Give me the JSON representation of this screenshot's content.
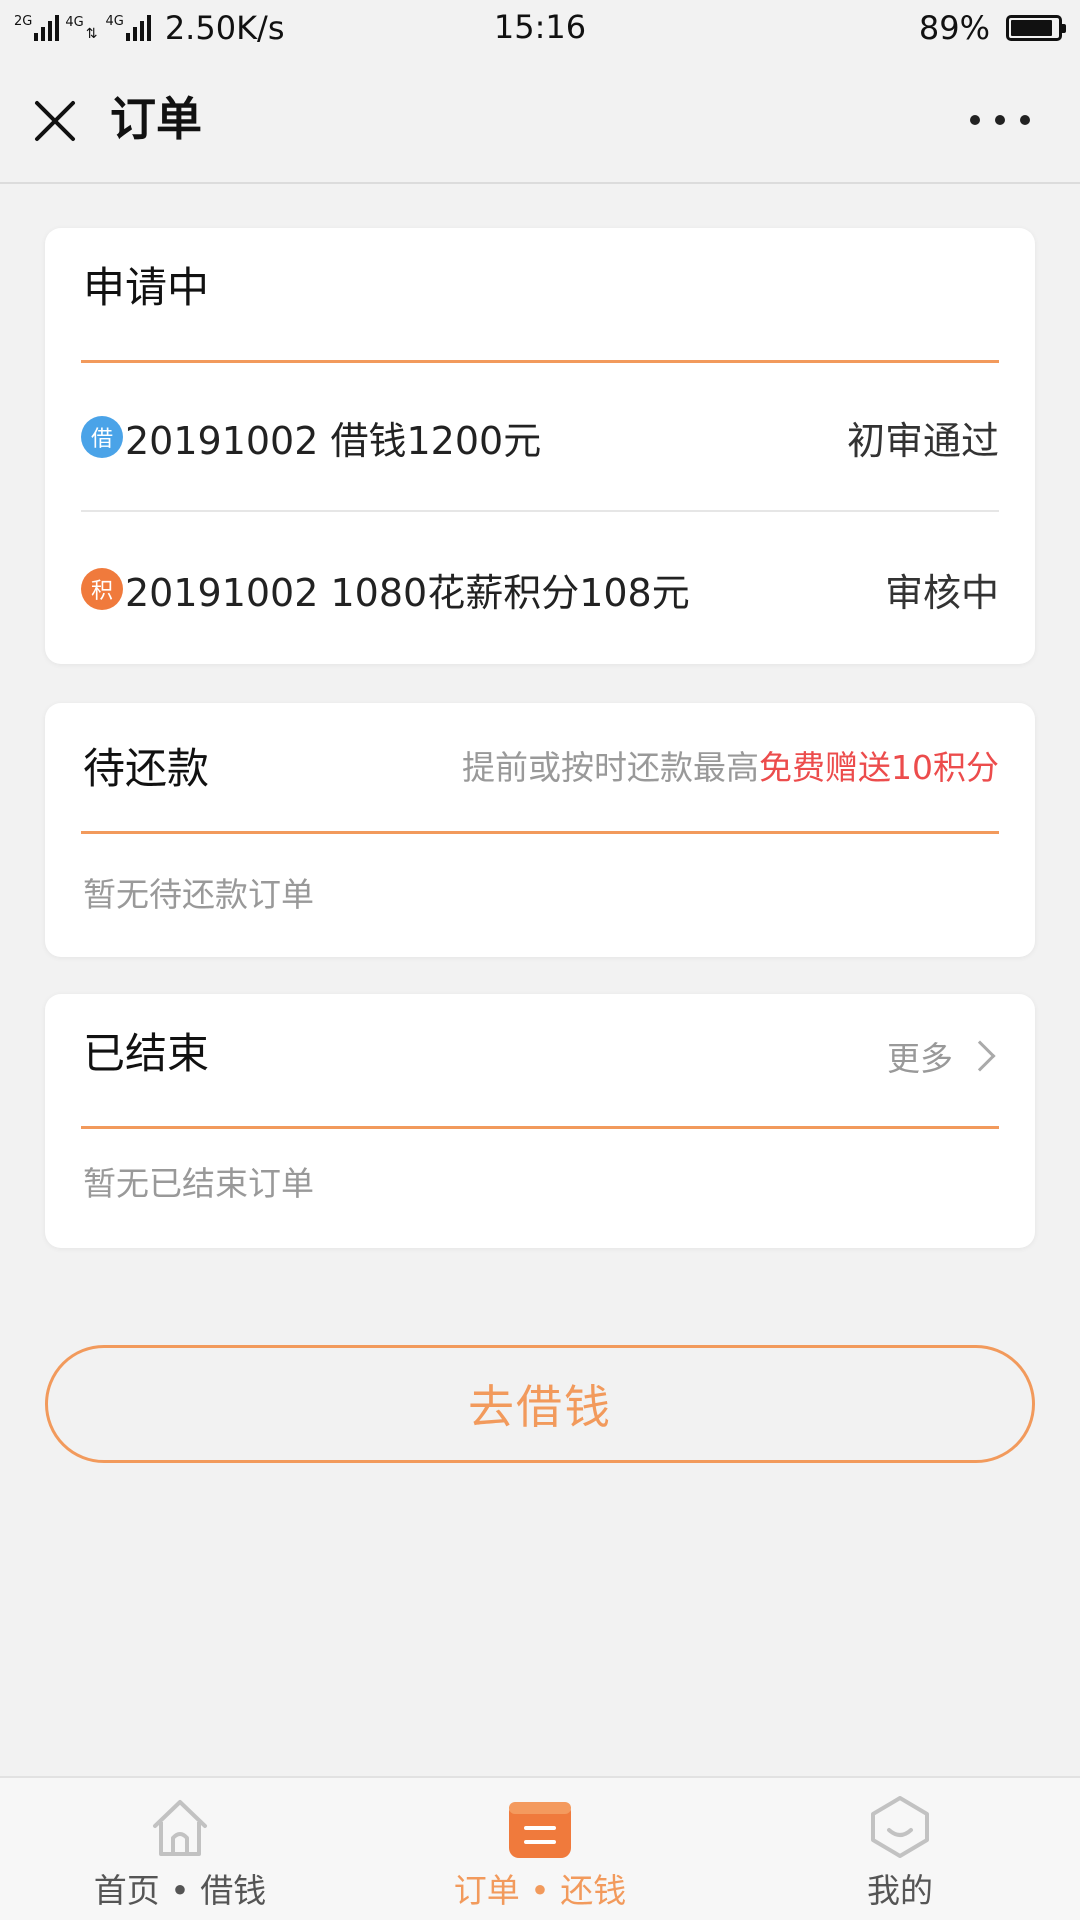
{
  "status_bar": {
    "signal_1": "2G",
    "signal_2": "4G",
    "signal_3": "4G",
    "speed": "2.50K/s",
    "time": "15:16",
    "battery": "89%",
    "battery_level": 0.89
  },
  "nav": {
    "title": "订单",
    "close_icon": "close-icon",
    "more_icon": "more-icon"
  },
  "applying": {
    "title": "申请中",
    "orders": [
      {
        "badge": "借",
        "badge_color": "#4aa3e8",
        "text": "20191002 借钱1200元",
        "status": "初审通过"
      },
      {
        "badge": "积",
        "badge_color": "#f07a3c",
        "text": "20191002 1080花薪积分108元",
        "status": "审核中"
      }
    ]
  },
  "pending": {
    "title": "待还款",
    "promo_prefix": "提前或按时还款最高",
    "promo_highlight": "免费赠送10积分",
    "empty": "暂无待还款订单"
  },
  "finished": {
    "title": "已结束",
    "more": "更多",
    "empty": "暂无已结束订单"
  },
  "borrow_button": "去借钱",
  "tabbar": {
    "items": [
      {
        "label": "首页 • 借钱",
        "icon": "home-icon"
      },
      {
        "label": "订单 • 还钱",
        "icon": "orders-icon"
      },
      {
        "label": "我的",
        "icon": "profile-icon"
      }
    ],
    "active_index": 1
  },
  "colors": {
    "accent": "#f29a5c",
    "highlight": "#ec4c4c",
    "background": "#f2f2f2"
  }
}
